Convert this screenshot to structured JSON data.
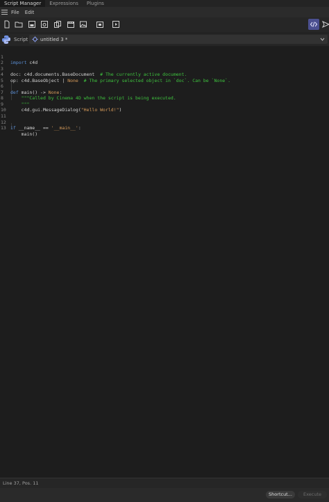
{
  "tabs": [
    "Script Manager",
    "Expressions",
    "Plugins"
  ],
  "menu": [
    "File",
    "Edit"
  ],
  "toolbar": {
    "icons": [
      "new-file-icon",
      "open-folder-icon",
      "save-icon",
      "save-as-icon",
      "duplicate-icon",
      "film-icon",
      "image-icon",
      "import-icon",
      "play-file-icon",
      "code-view-icon",
      "run-icon"
    ]
  },
  "script": {
    "label": "Script",
    "name": "untitled 3 *"
  },
  "code": {
    "lines": [
      {
        "n": "1",
        "t": "import c4d"
      },
      {
        "n": "2",
        "t": ""
      },
      {
        "n": "3",
        "t": "doc: c4d.documents.BaseDocument  # The currently active document."
      },
      {
        "n": "4",
        "t": "op: c4d.BaseObject | None  # The primary selected object in `doc`. Can be `None`."
      },
      {
        "n": "5",
        "t": ""
      },
      {
        "n": "6",
        "t": "def main() -> None:"
      },
      {
        "n": "7",
        "t": "    \"\"\"Called by Cinema 4D when the script is being executed."
      },
      {
        "n": "8",
        "t": "    \"\"\""
      },
      {
        "n": "9",
        "t": "    c4d.gui.MessageDialog(\"Hello World!\")"
      },
      {
        "n": "10",
        "t": ""
      },
      {
        "n": "11",
        "t": ""
      },
      {
        "n": "12",
        "t": "if __name__ == '__main__':"
      },
      {
        "n": "13",
        "t": "    main()"
      }
    ]
  },
  "status": {
    "text": "Line 37, Pos. 11"
  },
  "buttons": {
    "shortcut": "Shortcut...",
    "execute": "Execute"
  },
  "colors": {
    "highlight": "#4b4f8f",
    "comment": "#3ec33e",
    "keyword": "#5b8fd6",
    "string": "#d79b5a"
  }
}
